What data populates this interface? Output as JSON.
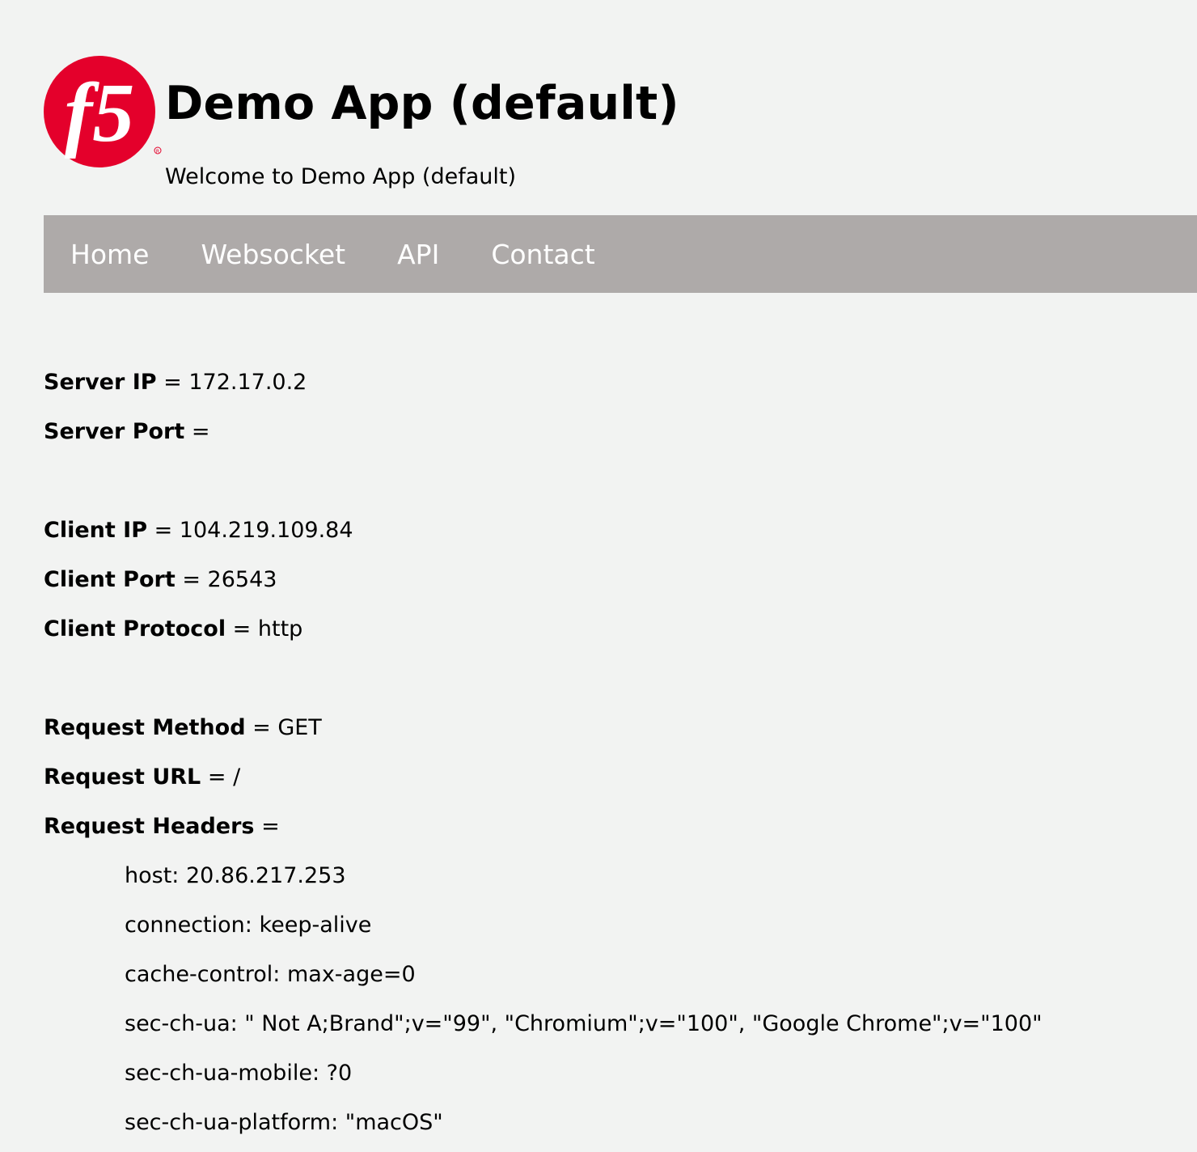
{
  "header": {
    "logo_text": "f5",
    "title": "Demo App (default)",
    "subtitle": "Welcome to Demo App (default)"
  },
  "nav": {
    "items": [
      {
        "label": "Home"
      },
      {
        "label": "Websocket"
      },
      {
        "label": "API"
      },
      {
        "label": "Contact"
      }
    ]
  },
  "server": {
    "ip_label": "Server IP",
    "ip_value": "172.17.0.2",
    "port_label": "Server Port",
    "port_value": ""
  },
  "client": {
    "ip_label": "Client IP",
    "ip_value": "104.219.109.84",
    "port_label": "Client Port",
    "port_value": "26543",
    "protocol_label": "Client Protocol",
    "protocol_value": "http"
  },
  "request": {
    "method_label": "Request Method",
    "method_value": "GET",
    "url_label": "Request URL",
    "url_value": "/",
    "headers_label": "Request Headers",
    "headers": [
      "host: 20.86.217.253",
      "connection: keep-alive",
      "cache-control: max-age=0",
      "sec-ch-ua: \" Not A;Brand\";v=\"99\", \"Chromium\";v=\"100\", \"Google Chrome\";v=\"100\"",
      "sec-ch-ua-mobile: ?0",
      "sec-ch-ua-platform: \"macOS\""
    ]
  },
  "colors": {
    "background": "#f2f3f2",
    "nav_background": "#aeaaa9",
    "nav_text": "#ffffff",
    "logo_red": "#e4002b"
  }
}
